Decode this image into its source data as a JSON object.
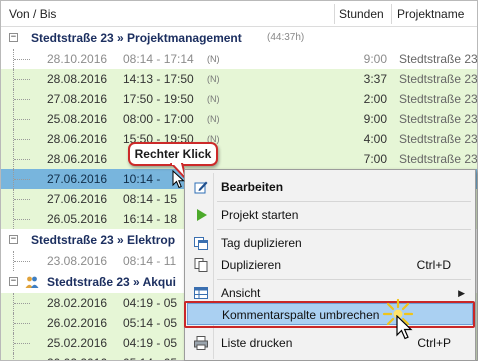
{
  "header": {
    "col_range": "Von / Bis",
    "col_hours": "Stunden",
    "col_project": "Projektname"
  },
  "groups": [
    {
      "title": "Stedtstraße 23 » Projektmanagement",
      "duration": "(44:37h)",
      "toggle": "−",
      "icon": "folder-icon"
    },
    {
      "title": "Stedtstraße 23 » Elektrop",
      "toggle": "−",
      "icon": "folder-icon"
    },
    {
      "title": "Stedtstraße 23 » Akqui",
      "toggle": "−",
      "icon": "people-icon"
    }
  ],
  "rows_group1": [
    {
      "date": "28.10.2016",
      "time": "08:14 - 17:14",
      "tag": "(N)",
      "hours": "9:00",
      "project": "Stedtstraße 23",
      "style": "grey"
    },
    {
      "date": "28.08.2016",
      "time": "14:13 - 17:50",
      "tag": "(N)",
      "hours": "3:37",
      "project": "Stedtstraße 23",
      "style": "green"
    },
    {
      "date": "27.08.2016",
      "time": "17:50 - 19:50",
      "tag": "(N)",
      "hours": "2:00",
      "project": "Stedtstraße 23",
      "style": "green"
    },
    {
      "date": "25.08.2016",
      "time": "08:00 - 17:00",
      "tag": "(N)",
      "hours": "9:00",
      "project": "Stedtstraße 23",
      "style": "green"
    },
    {
      "date": "28.06.2016",
      "time": "15:50 - 19:50",
      "tag": "(N)",
      "hours": "4:00",
      "project": "Stedtstraße 23",
      "style": "green"
    },
    {
      "date": "28.06.2016",
      "time": "",
      "tag": "",
      "hours": "7:00",
      "project": "Stedtstraße 23",
      "style": "green"
    },
    {
      "date": "27.06.2016",
      "time": "10:14 -",
      "tag": "",
      "hours": "",
      "project": "",
      "style": "sel"
    },
    {
      "date": "27.06.2016",
      "time": "08:14 - 15",
      "tag": "",
      "hours": "",
      "project": "",
      "style": "green"
    },
    {
      "date": "26.05.2016",
      "time": "16:14 - 18",
      "tag": "",
      "hours": "",
      "project": "",
      "style": "green"
    }
  ],
  "rows_group2": [
    {
      "date": "23.08.2016",
      "time": "08:14 - 11",
      "style": "grey"
    }
  ],
  "rows_group3": [
    {
      "date": "28.02.2016",
      "time": "04:19 - 05",
      "style": "green"
    },
    {
      "date": "26.02.2016",
      "time": "05:14 - 05",
      "style": "green"
    },
    {
      "date": "25.02.2016",
      "time": "04:19 - 05",
      "style": "green"
    },
    {
      "date": "20.02.2016",
      "time": "05:14 - 05",
      "style": "green"
    }
  ],
  "callout": {
    "label": "Rechter Klick"
  },
  "context_menu": {
    "items": [
      {
        "label": "Bearbeiten",
        "icon": "edit-icon",
        "shortcut": ""
      },
      {
        "label": "Projekt starten",
        "icon": "play-icon",
        "shortcut": ""
      },
      {
        "label": "Tag duplizieren",
        "icon": "calendar-copy-icon",
        "shortcut": ""
      },
      {
        "label": "Duplizieren",
        "icon": "copy-icon",
        "shortcut": "Ctrl+D"
      },
      {
        "label": "Ansicht",
        "icon": "view-icon",
        "shortcut": "",
        "submenu": "▶"
      },
      {
        "label": "Kommentarspalte umbrechen",
        "icon": "",
        "shortcut": ""
      },
      {
        "label": "Liste drucken",
        "icon": "print-icon",
        "shortcut": "Ctrl+P"
      }
    ]
  },
  "colors": {
    "row_green": "#e6f6d6",
    "row_selected": "#78b5dd",
    "menu_highlight": "#aad0f2",
    "callout_border": "#cc2a2a",
    "group_title": "#1c2f60"
  }
}
